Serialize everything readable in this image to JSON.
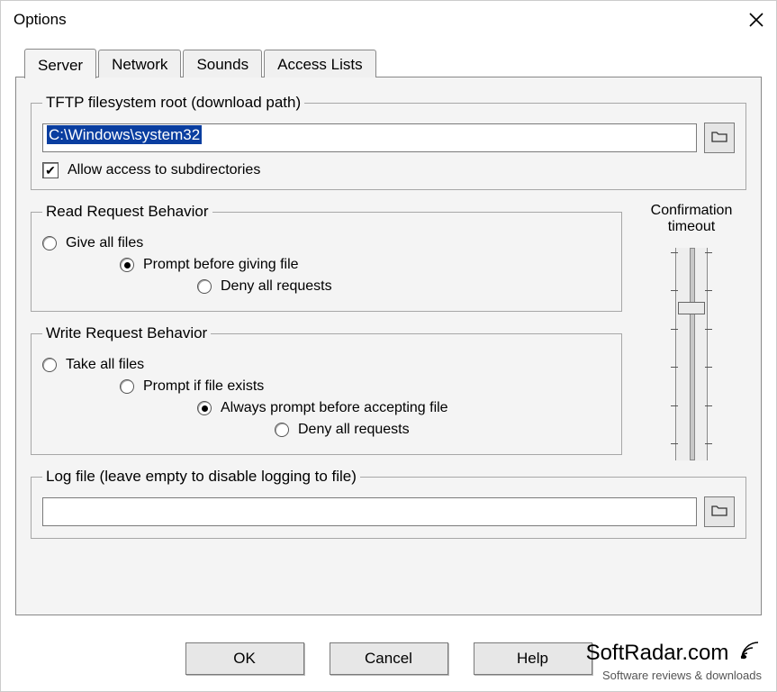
{
  "window": {
    "title": "Options"
  },
  "tabs": [
    {
      "label": "Server",
      "active": true
    },
    {
      "label": "Network",
      "active": false
    },
    {
      "label": "Sounds",
      "active": false
    },
    {
      "label": "Access Lists",
      "active": false
    }
  ],
  "filesystem": {
    "legend": "TFTP filesystem root (download path)",
    "path": "C:\\Windows\\system32",
    "allow_subdirs_label": "Allow access to subdirectories",
    "allow_subdirs_checked": true
  },
  "read_behavior": {
    "legend": "Read Request Behavior",
    "options": [
      {
        "label": "Give all files",
        "selected": false,
        "indent": 0
      },
      {
        "label": "Prompt before giving file",
        "selected": true,
        "indent": 1
      },
      {
        "label": "Deny all requests",
        "selected": false,
        "indent": 2
      }
    ]
  },
  "write_behavior": {
    "legend": "Write Request Behavior",
    "options": [
      {
        "label": "Take all files",
        "selected": false,
        "indent": 0
      },
      {
        "label": "Prompt if file exists",
        "selected": false,
        "indent": 1
      },
      {
        "label": "Always prompt before accepting file",
        "selected": true,
        "indent": 2
      },
      {
        "label": "Deny all requests",
        "selected": false,
        "indent": 3
      }
    ]
  },
  "confirmation": {
    "label_line1": "Confirmation",
    "label_line2": "timeout",
    "slider_value": 0.26
  },
  "logfile": {
    "legend": "Log file (leave empty to disable logging to file)",
    "value": ""
  },
  "buttons": {
    "ok": "OK",
    "cancel": "Cancel",
    "help": "Help"
  },
  "watermark": {
    "brand": "SoftRadar.com",
    "tagline": "Software reviews & downloads"
  }
}
